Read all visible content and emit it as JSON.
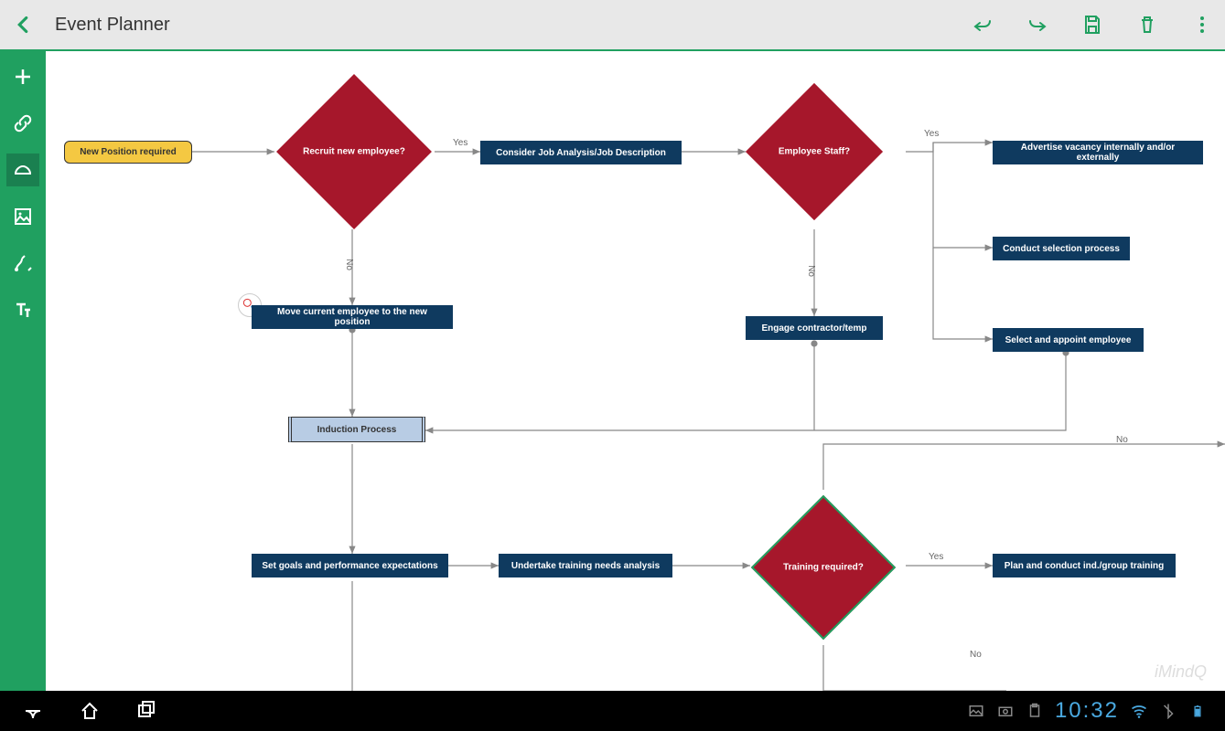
{
  "header": {
    "title": "Event Planner"
  },
  "nodes": {
    "new_position": "New Position required",
    "recruit_decision": "Recruit new employee?",
    "consider_job": "Consider Job Analysis/Job Description",
    "employee_staff": "Employee Staff?",
    "advertise": "Advertise vacancy internally and/or externally",
    "conduct_selection": "Conduct selection process",
    "select_appoint": "Select and appoint employee",
    "move_employee": "Move current employee to the new position",
    "engage_contractor": "Engage contractor/temp",
    "induction": "Induction Process",
    "set_goals": "Set goals and performance expectations",
    "undertake_training": "Undertake training needs analysis",
    "training_required": "Training required?",
    "plan_training": "Plan and conduct ind./group training"
  },
  "labels": {
    "yes": "Yes",
    "no": "No"
  },
  "watermark": "iMindQ",
  "system": {
    "time": "10:32"
  }
}
